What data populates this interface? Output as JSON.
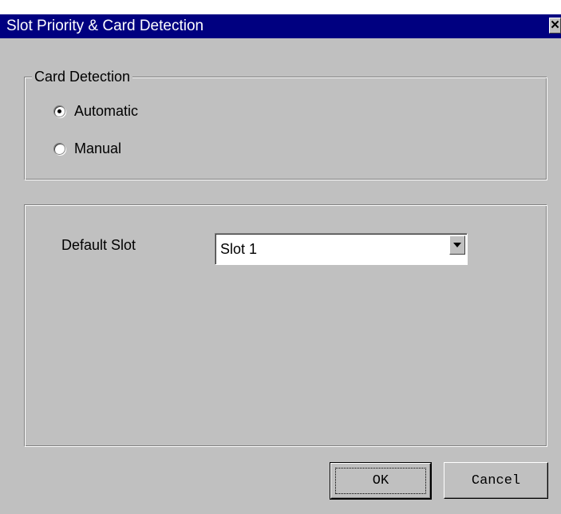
{
  "window": {
    "title": "Slot Priority & Card Detection",
    "close_glyph": "✕"
  },
  "card_detection": {
    "legend": "Card Detection",
    "options": [
      {
        "label": "Automatic",
        "checked": true
      },
      {
        "label": "Manual",
        "checked": false
      }
    ]
  },
  "slot": {
    "label": "Default Slot",
    "selected": "Slot 1"
  },
  "buttons": {
    "ok": "OK",
    "cancel": "Cancel"
  },
  "icons": {
    "close": "close-icon",
    "dropdown": "chevron-down-icon"
  }
}
